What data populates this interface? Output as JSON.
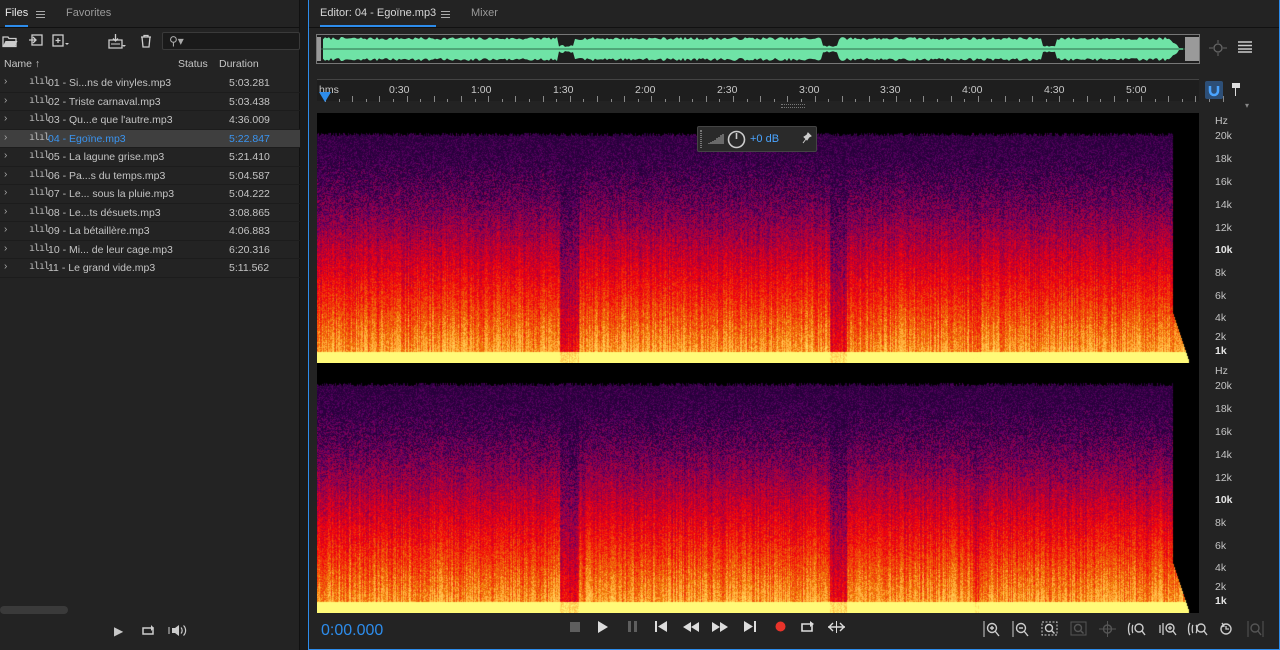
{
  "files_panel": {
    "tabs": [
      {
        "label": "Files"
      },
      {
        "label": "Favorites"
      }
    ],
    "columns": {
      "name": "Name",
      "status": "Status",
      "duration": "Duration"
    },
    "files": [
      {
        "name": "01 - Si...ns de vinyles.mp3",
        "duration": "5:03.281"
      },
      {
        "name": "02 - Triste carnaval.mp3",
        "duration": "5:03.438"
      },
      {
        "name": "03 - Qu...e que l'autre.mp3",
        "duration": "4:36.009"
      },
      {
        "name": "04 - Egoïne.mp3",
        "duration": "5:22.847"
      },
      {
        "name": "05 - La lagune grise.mp3",
        "duration": "5:21.410"
      },
      {
        "name": "06 - Pa...s du temps.mp3",
        "duration": "5:04.587"
      },
      {
        "name": "07 - Le... sous la pluie.mp3",
        "duration": "5:04.222"
      },
      {
        "name": "08 - Le...ts désuets.mp3",
        "duration": "3:08.865"
      },
      {
        "name": "09 - La bétaillère.mp3",
        "duration": "4:06.883"
      },
      {
        "name": "10 - Mi... de leur cage.mp3",
        "duration": "6:20.316"
      },
      {
        "name": "11 - Le grand vide.mp3",
        "duration": "5:11.562"
      }
    ],
    "selected_index": 3
  },
  "editor": {
    "tabs": [
      {
        "label": "Editor: 04 - Egoïne.mp3"
      },
      {
        "label": "Mixer"
      }
    ],
    "ruler": {
      "unit_label": "hms",
      "ticks": [
        "0:30",
        "1:00",
        "1:30",
        "2:00",
        "2:30",
        "3:00",
        "3:30",
        "4:00",
        "4:30",
        "5:00"
      ]
    },
    "freq_axis": {
      "unit": "Hz",
      "labels": [
        "20k",
        "18k",
        "16k",
        "14k",
        "12k",
        "10k",
        "8k",
        "6k",
        "4k",
        "2k",
        "1k"
      ]
    },
    "hud": {
      "gain": "+0 dB"
    },
    "time_display": "0:00.000"
  },
  "colors": {
    "accent": "#2d8ceb",
    "waveform": "#6fe3a6"
  }
}
